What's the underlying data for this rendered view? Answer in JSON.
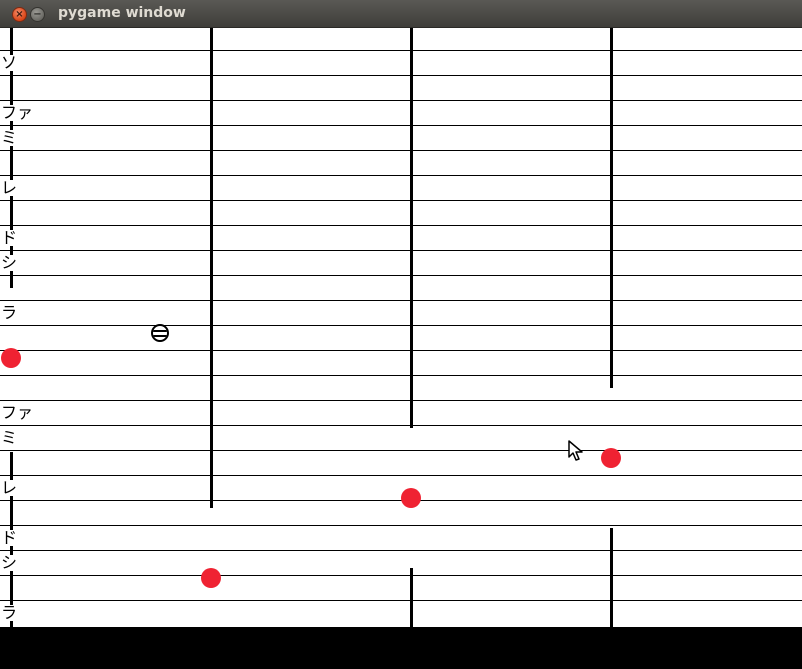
{
  "window": {
    "title": "pygame window"
  },
  "titlebar_buttons": {
    "close_icon": "close-icon",
    "minimize_icon": "minimize-icon"
  },
  "note_labels": [
    {
      "text": "ソ"
    },
    {
      "text": "ファ"
    },
    {
      "text": "ミ"
    },
    {
      "text": "レ"
    },
    {
      "text": "ド"
    },
    {
      "text": "シ"
    },
    {
      "text": "ラ"
    },
    {
      "text": "ファ"
    },
    {
      "text": "ミ"
    },
    {
      "text": "レ"
    },
    {
      "text": "ド"
    },
    {
      "text": "シ"
    },
    {
      "text": "ラ"
    }
  ],
  "note_dots": [
    {
      "color": "#ef2232"
    },
    {
      "color": "#ef2232"
    },
    {
      "color": "#ef2232"
    },
    {
      "color": "#ef2232"
    }
  ],
  "cursor_ball": {
    "icon": "striped-ball-icon"
  },
  "mouse_pointer": {
    "icon": "mouse-pointer-icon"
  },
  "colors": {
    "note": "#ef2232",
    "staff": "#000000",
    "background": "#ffffff",
    "footer": "#000000"
  }
}
